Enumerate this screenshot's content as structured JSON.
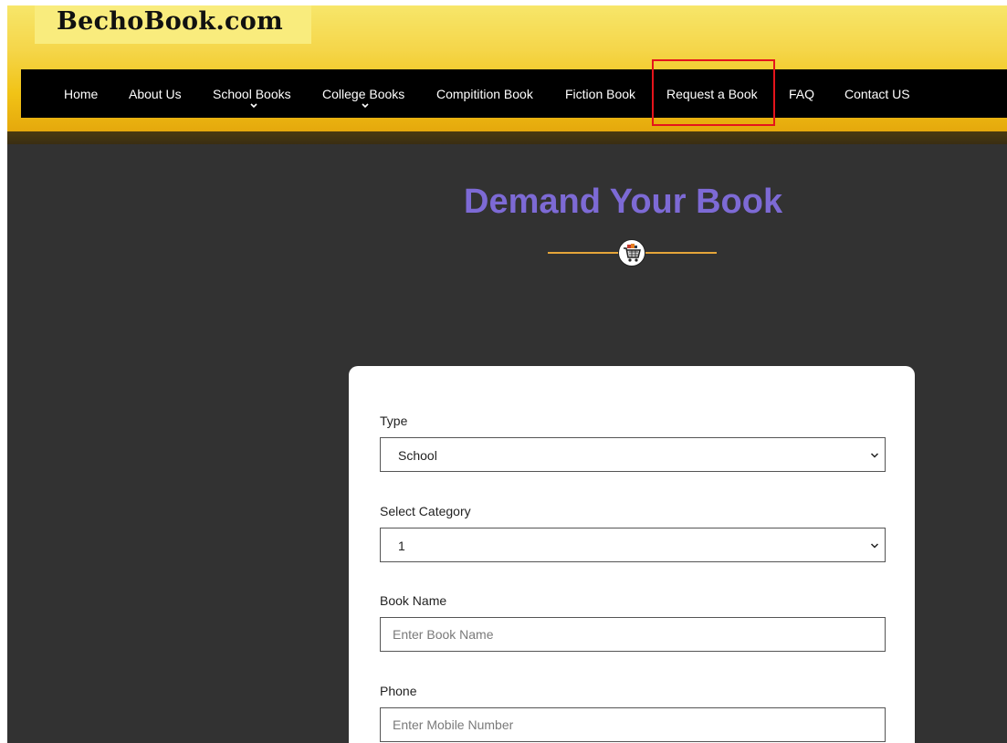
{
  "brand": {
    "logo_text": "BechoBook.com"
  },
  "nav": {
    "items": [
      {
        "label": "Home"
      },
      {
        "label": "About Us"
      },
      {
        "label": "School Books"
      },
      {
        "label": "College Books"
      },
      {
        "label": "Compitition Book"
      },
      {
        "label": "Fiction Book"
      },
      {
        "label": "Request a Book"
      },
      {
        "label": "FAQ"
      },
      {
        "label": "Contact US"
      }
    ]
  },
  "hero": {
    "title": "Demand Your Book",
    "divider_icon": "shopping-cart-icon",
    "accent_color": "#7d6ad5",
    "divider_color": "#e5a53a"
  },
  "form": {
    "type": {
      "label": "Type",
      "value": "School"
    },
    "category": {
      "label": "Select Category",
      "value": "1"
    },
    "book_name": {
      "label": "Book Name",
      "placeholder": "Enter Book Name"
    },
    "phone": {
      "label": "Phone",
      "placeholder": "Enter Mobile Number"
    }
  },
  "highlight_color": "#e5141b"
}
